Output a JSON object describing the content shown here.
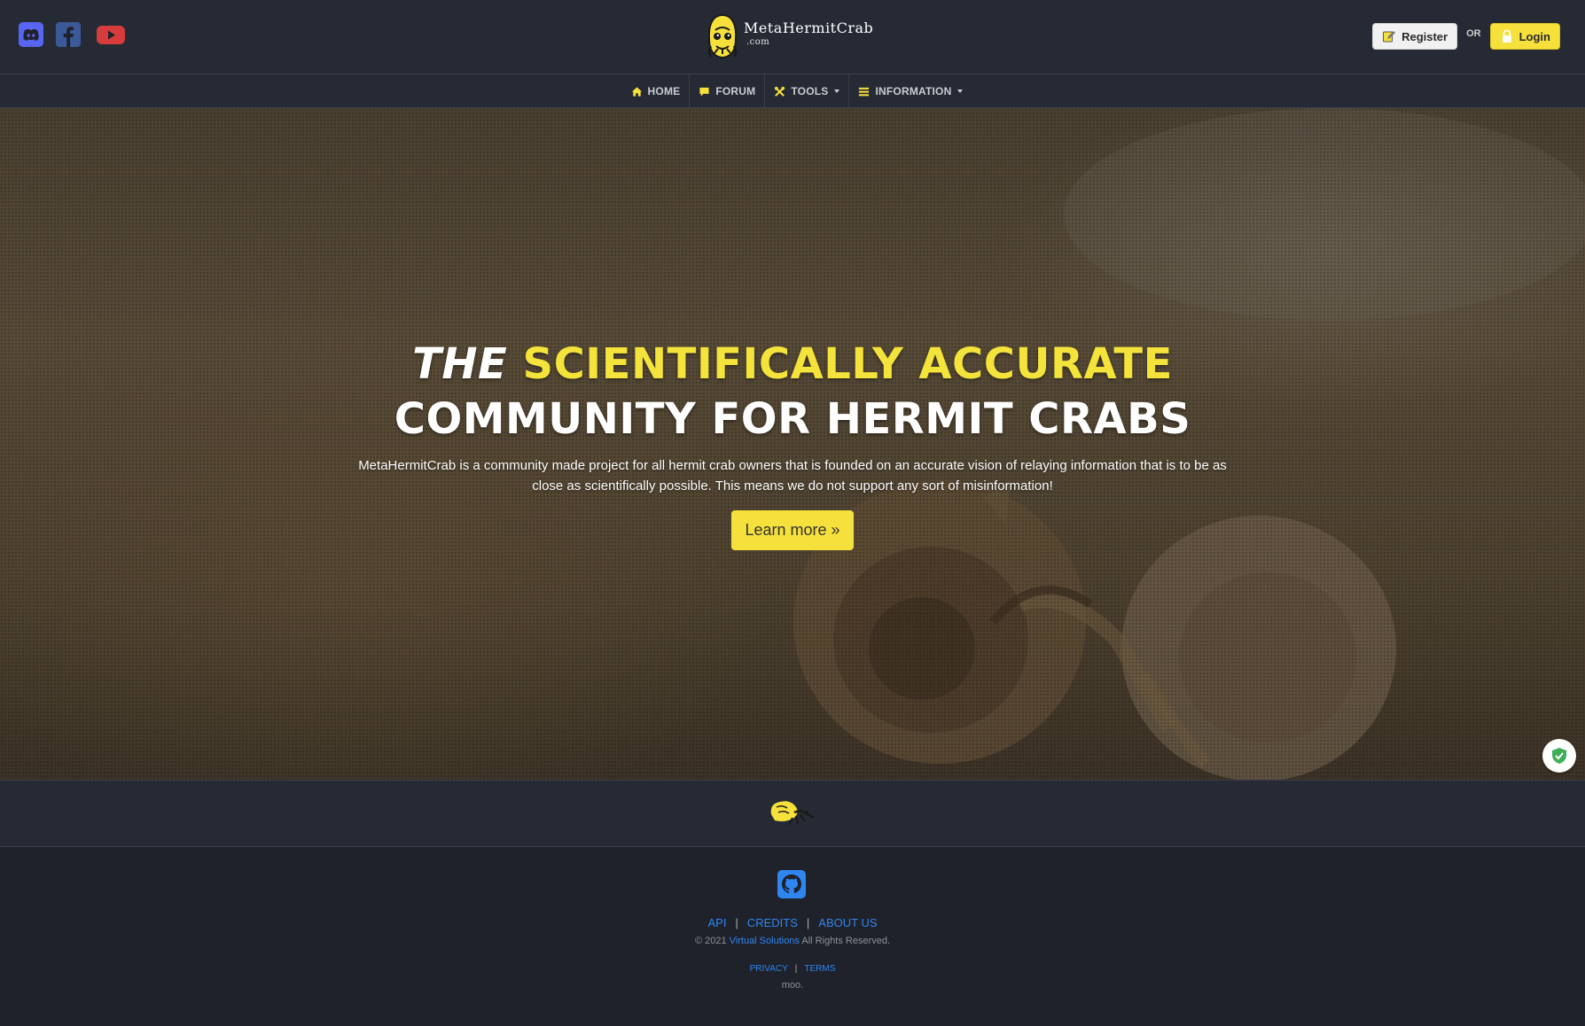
{
  "header": {
    "brand_name": "MetaHermitCrab",
    "brand_tld": ".com",
    "social": [
      {
        "name": "discord-icon",
        "color": "#5865F2"
      },
      {
        "name": "facebook-icon",
        "color": "#3b5998"
      },
      {
        "name": "youtube-icon",
        "color": "#d63c3c"
      }
    ],
    "register_label": "Register",
    "or_label": "OR",
    "login_label": "Login"
  },
  "nav": {
    "home": "HOME",
    "forum": "FORUM",
    "tools": "TOOLS",
    "information": "INFORMATION"
  },
  "hero": {
    "title_the": "THE",
    "title_highlight": "SCIENTIFICALLY ACCURATE",
    "title_line2": "COMMUNITY FOR HERMIT CRABS",
    "description": "MetaHermitCrab is a community made project for all hermit crab owners that is founded on an accurate vision of relaying information that is to be as close as scientifically possible. This means we do not support any sort of misinformation!",
    "button_label": "Learn more »"
  },
  "footer": {
    "links": [
      "API",
      "CREDITS",
      "ABOUT US"
    ],
    "separator": "|",
    "copyright_prefix": "© 2021",
    "copyright_link": "Virtual Solutions",
    "copyright_suffix": "All Rights Reserved.",
    "legal": [
      "PRIVACY",
      "TERMS"
    ],
    "tagline": "moo."
  },
  "colors": {
    "accent_yellow": "#f6e03c",
    "link_blue": "#2f86f0",
    "bar_bg": "#262a35",
    "page_bg": "#1f222b"
  }
}
